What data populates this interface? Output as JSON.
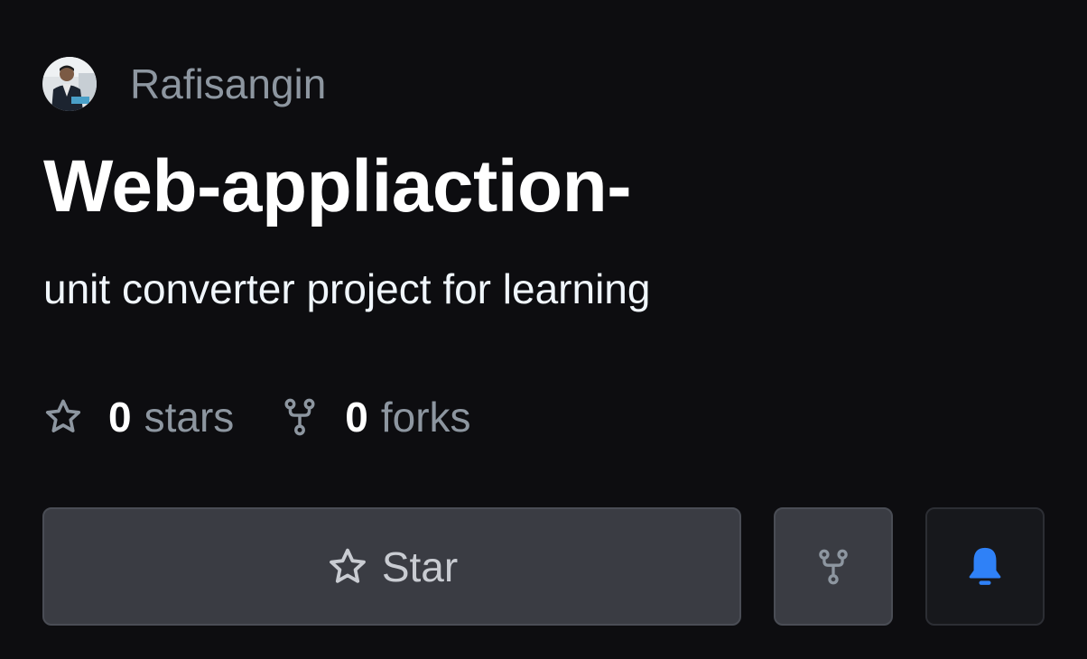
{
  "owner": {
    "name": "Rafisangin",
    "avatar_icon": "user-avatar"
  },
  "repo": {
    "title": "Web-appliaction-",
    "description": "unit converter project for learning"
  },
  "stats": {
    "stars_count": "0",
    "stars_label": "stars",
    "forks_count": "0",
    "forks_label": "forks"
  },
  "actions": {
    "star_label": "Star",
    "fork_icon": "fork-icon",
    "watch_icon": "bell-icon"
  },
  "colors": {
    "background": "#0d0d10",
    "muted_text": "#8d96a0",
    "primary_text": "#ffffff",
    "button_bg": "#3a3c43",
    "accent_blue": "#2f81f7"
  }
}
